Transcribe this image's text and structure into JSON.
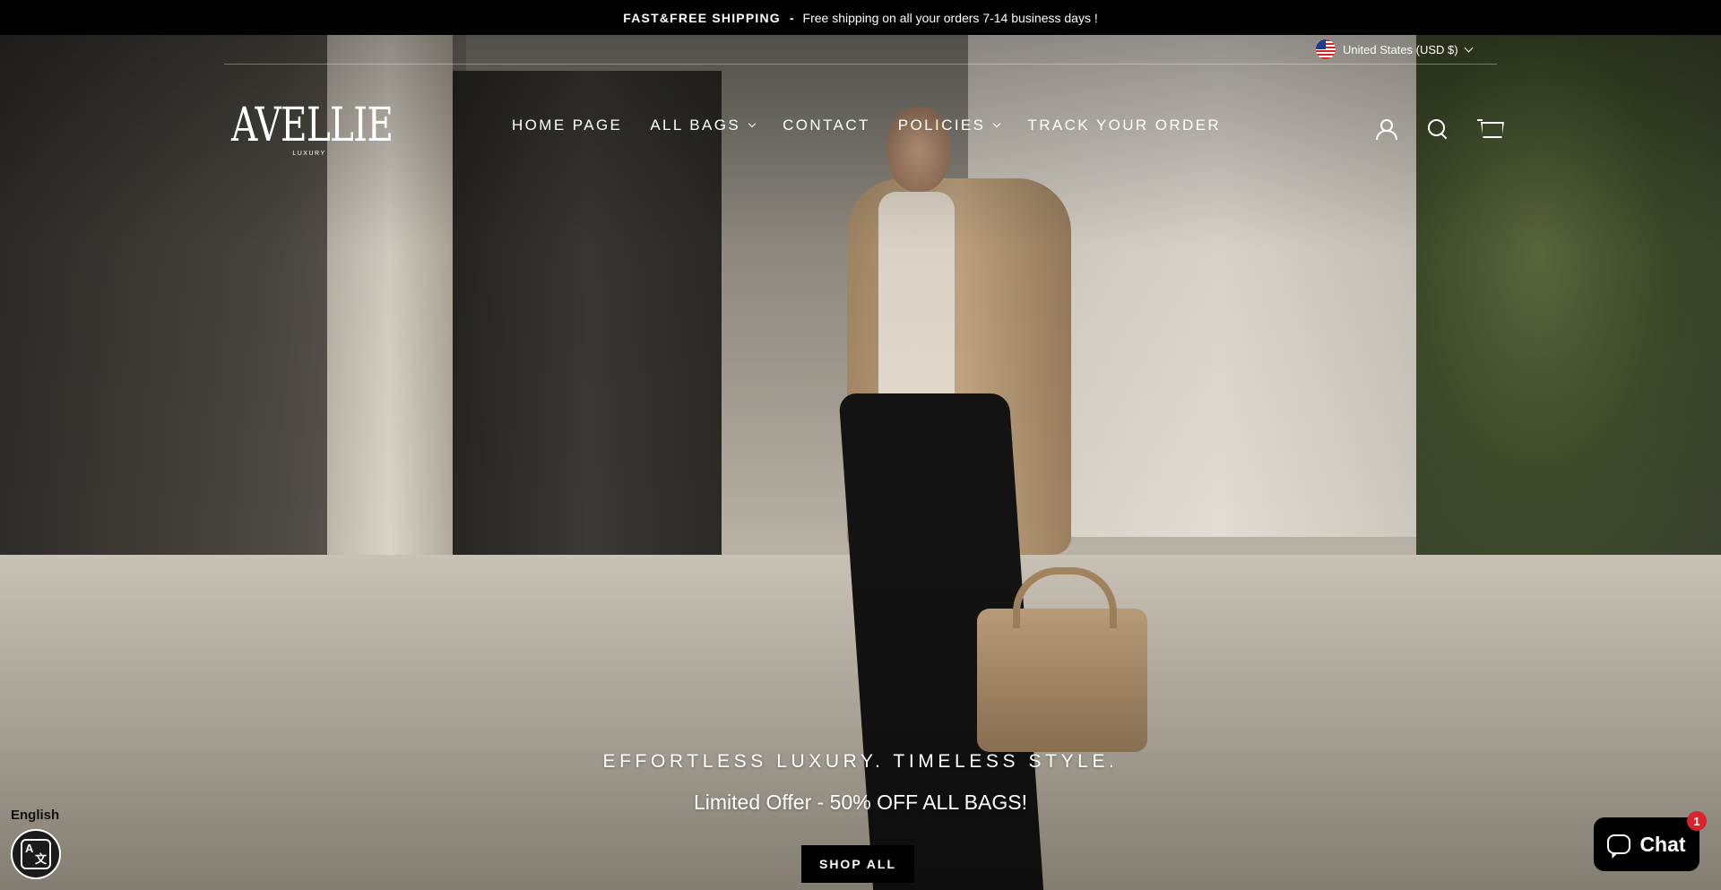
{
  "announcement": {
    "strong": "FAST&FREE SHIPPING",
    "separator": "-",
    "text": "Free shipping on all your orders 7-14 business days !"
  },
  "country_selector": {
    "label": "United States (USD $)",
    "flag": "us-flag-icon"
  },
  "logo": {
    "word": "AVELLIE",
    "sub": "LUXURY"
  },
  "nav": {
    "items": [
      {
        "label": "HOME PAGE",
        "dropdown": false
      },
      {
        "label": "ALL BAGS",
        "dropdown": true
      },
      {
        "label": "CONTACT",
        "dropdown": false
      },
      {
        "label": "POLICIES",
        "dropdown": true
      },
      {
        "label": "TRACK YOUR ORDER",
        "dropdown": false
      }
    ]
  },
  "header_icons": [
    "account-icon",
    "search-icon",
    "cart-icon"
  ],
  "hero": {
    "tagline": "EFFORTLESS LUXURY. TIMELESS STYLE.",
    "offer": "Limited Offer - 50% OFF ALL BAGS!",
    "cta": "SHOP ALL"
  },
  "language": {
    "label": "English",
    "icon": "translate-icon"
  },
  "chat": {
    "label": "Chat",
    "badge": "1",
    "icon": "chat-bubble-icon"
  },
  "colors": {
    "announcement_bg": "#000000",
    "cta_bg": "#000000",
    "chat_badge": "#d7232b"
  }
}
